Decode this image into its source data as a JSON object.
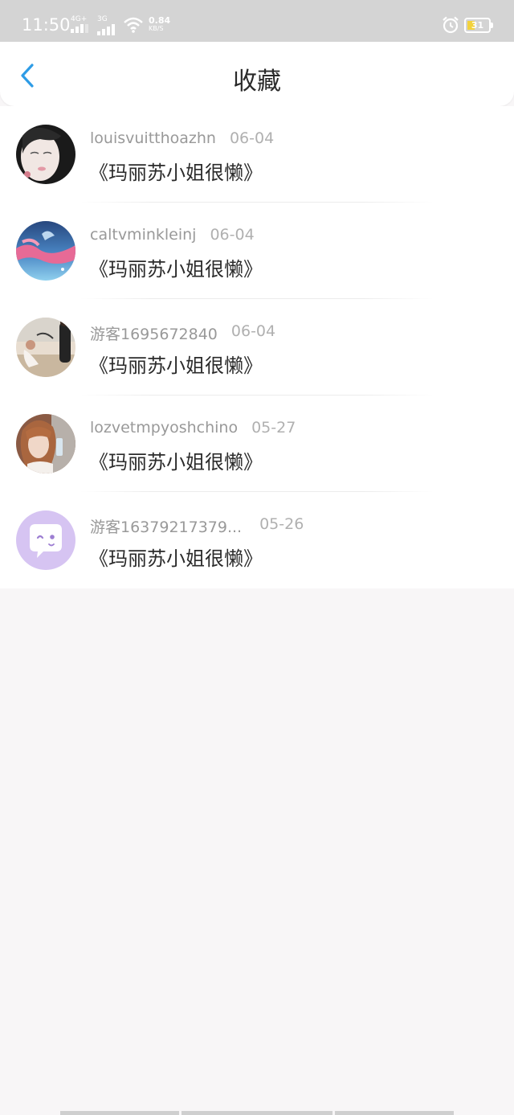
{
  "status_bar": {
    "time": "11:50",
    "network_1": "4G+",
    "network_2": "3G",
    "speed_value": "0.84",
    "speed_unit": "KB/S",
    "battery_level": "31"
  },
  "header": {
    "title": "收藏",
    "back_icon": "chevron-left-icon"
  },
  "favorites": [
    {
      "username": "louisvuitthoazhn",
      "date": "06-04",
      "book_title": "《玛丽苏小姐很懒》"
    },
    {
      "username": "caltvminkleinj",
      "date": "06-04",
      "book_title": "《玛丽苏小姐很懒》"
    },
    {
      "username": "游客1695672840",
      "date": "06-04",
      "book_title": "《玛丽苏小姐很懒》"
    },
    {
      "username": "lozvetmpyoshchino",
      "date": "05-27",
      "book_title": "《玛丽苏小姐很懒》"
    },
    {
      "username": "游客16379217379...",
      "date": "05-26",
      "book_title": "《玛丽苏小姐很懒》"
    }
  ],
  "colors": {
    "accent": "#2e9ce6",
    "status_bar": "#d4d4d4",
    "page_bg": "#f8f6f7",
    "default_avatar": "#d6c4f2"
  }
}
